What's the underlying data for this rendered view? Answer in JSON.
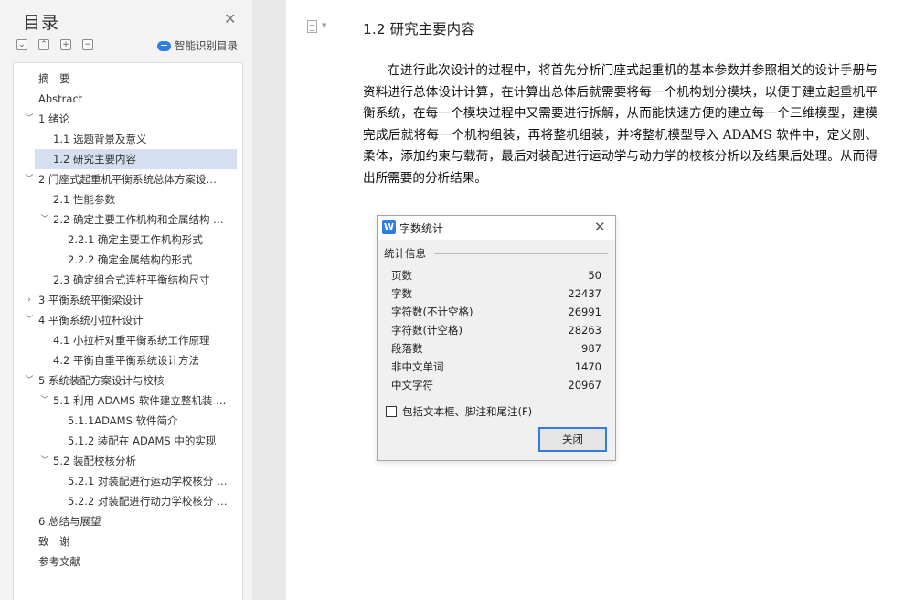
{
  "toc": {
    "title": "目录",
    "smart_toc_label": "智能识别目录",
    "items": [
      {
        "label": "摘　要",
        "level": 1,
        "chevron": ""
      },
      {
        "label": "Abstract",
        "level": 1,
        "chevron": ""
      },
      {
        "label": "1 绪论",
        "level": 1,
        "chevron": "﹀"
      },
      {
        "label": "1.1 选题背景及意义",
        "level": 2,
        "chevron": ""
      },
      {
        "label": "1.2 研究主要内容",
        "level": 2,
        "chevron": "",
        "selected": true
      },
      {
        "label": "2 门座式起重机平衡系统总体方案设…",
        "level": 1,
        "chevron": "﹀"
      },
      {
        "label": "2.1 性能参数",
        "level": 2,
        "chevron": ""
      },
      {
        "label": "2.2  确定主要工作机构和金属结构 …",
        "level": 2,
        "chevron": "﹀"
      },
      {
        "label": "2.2.1 确定主要工作机构形式",
        "level": 3,
        "chevron": ""
      },
      {
        "label": "2.2.2 确定金属结构的形式",
        "level": 3,
        "chevron": ""
      },
      {
        "label": "2.3  确定组合式连杆平衡结构尺寸",
        "level": 2,
        "chevron": ""
      },
      {
        "label": "3 平衡系统平衡梁设计",
        "level": 1,
        "chevron": "›"
      },
      {
        "label": "4 平衡系统小拉杆设计",
        "level": 1,
        "chevron": "﹀"
      },
      {
        "label": "4.1 小拉杆对重平衡系统工作原理",
        "level": 2,
        "chevron": ""
      },
      {
        "label": "4.2 平衡自重平衡系统设计方法",
        "level": 2,
        "chevron": ""
      },
      {
        "label": "5 系统装配方案设计与校核",
        "level": 1,
        "chevron": "﹀"
      },
      {
        "label": "5.1 利用 ADAMS 软件建立整机装 …",
        "level": 2,
        "chevron": "﹀"
      },
      {
        "label": "5.1.1ADAMS 软件简介",
        "level": 3,
        "chevron": ""
      },
      {
        "label": "5.1.2 装配在 ADAMS 中的实现",
        "level": 3,
        "chevron": ""
      },
      {
        "label": "5.2 装配校核分析",
        "level": 2,
        "chevron": "﹀"
      },
      {
        "label": "5.2.1 对装配进行运动学校核分 …",
        "level": 3,
        "chevron": ""
      },
      {
        "label": "5.2.2 对装配进行动力学校核分 …",
        "level": 3,
        "chevron": ""
      },
      {
        "label": "6 总结与展望",
        "level": 1,
        "chevron": ""
      },
      {
        "label": "致　谢",
        "level": 1,
        "chevron": ""
      },
      {
        "label": "参考文献",
        "level": 1,
        "chevron": ""
      }
    ]
  },
  "document": {
    "heading": "1.2 研究主要内容",
    "paragraph": "在进行此次设计的过程中，将首先分析门座式起重机的基本参数并参照相关的设计手册与资料进行总体设计计算，在计算出总体后就需要将每一个机构划分模块，以便于建立起重机平衡系统，在每一个模块过程中又需要进行拆解，从而能快速方便的建立每一个三维模型，建模完成后就将每一个机构组装，再将整机组装，并将整机模型导入 ADAMS 软件中，定义刚、柔体，添加约束与载荷，最后对装配进行运动学与动力学的校核分析以及结果后处理。从而得出所需要的分析结果。"
  },
  "dialog": {
    "title": "字数统计",
    "group_label": "统计信息",
    "stats": [
      {
        "label": "页数",
        "value": "50"
      },
      {
        "label": "字数",
        "value": "22437"
      },
      {
        "label": "字符数(不计空格)",
        "value": "26991"
      },
      {
        "label": "字符数(计空格)",
        "value": "28263"
      },
      {
        "label": "段落数",
        "value": "987"
      },
      {
        "label": "非中文单词",
        "value": "1470"
      },
      {
        "label": "中文字符",
        "value": "20967"
      }
    ],
    "checkbox_label": "包括文本框、脚注和尾注(F)",
    "checkbox_checked": false,
    "close_button": "关闭"
  }
}
